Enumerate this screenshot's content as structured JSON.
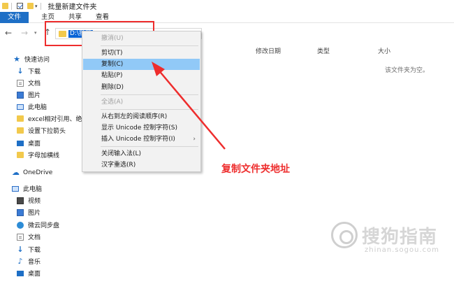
{
  "window": {
    "title": "批量新建文件夹"
  },
  "ribbon": {
    "tabs": [
      "文件",
      "主页",
      "共享",
      "查看"
    ]
  },
  "address": {
    "selected_text": "D:\\批量"
  },
  "columns": {
    "date": "修改日期",
    "type": "类型",
    "size": "大小"
  },
  "empty_message": "该文件夹为空。",
  "sidebar": {
    "items": [
      {
        "label": "快速访问",
        "icon": "star-icon"
      },
      {
        "label": "下载",
        "icon": "download-icon"
      },
      {
        "label": "文档",
        "icon": "document-icon"
      },
      {
        "label": "图片",
        "icon": "picture-icon"
      },
      {
        "label": "此电脑",
        "icon": "computer-icon"
      },
      {
        "label": "excel相对引用、绝对",
        "icon": "folder-icon"
      },
      {
        "label": "设置下拉箭头",
        "icon": "folder-icon"
      },
      {
        "label": "桌面",
        "icon": "desktop-icon"
      },
      {
        "label": "字母加横线",
        "icon": "folder-icon"
      },
      {
        "label": "OneDrive",
        "icon": "cloud-icon"
      },
      {
        "label": "此电脑",
        "icon": "computer-icon"
      },
      {
        "label": "视频",
        "icon": "video-icon"
      },
      {
        "label": "图片",
        "icon": "picture-icon"
      },
      {
        "label": "微云同步盘",
        "icon": "cloud-sync-icon"
      },
      {
        "label": "文档",
        "icon": "document-icon"
      },
      {
        "label": "下载",
        "icon": "download-icon"
      },
      {
        "label": "音乐",
        "icon": "music-icon"
      },
      {
        "label": "桌面",
        "icon": "desktop-icon"
      }
    ]
  },
  "context_menu": {
    "items": [
      {
        "label": "撤消(U)",
        "disabled": true
      },
      {
        "label": "剪切(T)"
      },
      {
        "label": "复制(C)",
        "highlighted": true
      },
      {
        "label": "粘贴(P)"
      },
      {
        "label": "删除(D)"
      },
      {
        "label": "全选(A)",
        "disabled": true
      },
      {
        "label": "从右到左的阅读顺序(R)"
      },
      {
        "label": "显示 Unicode 控制字符(S)"
      },
      {
        "label": "插入 Unicode 控制字符(I)",
        "submenu": true
      },
      {
        "label": "关闭输入法(L)"
      },
      {
        "label": "汉字重选(R)"
      }
    ]
  },
  "annotation": {
    "text": "复制文件夹地址",
    "color": "#ee2d2d"
  },
  "watermark": {
    "text": "搜狗指南",
    "url": "zhinan.sogou.com"
  },
  "colors": {
    "accent": "#1e6fc6",
    "selection": "#0a64d6",
    "menu_highlight": "#91c9f7"
  }
}
